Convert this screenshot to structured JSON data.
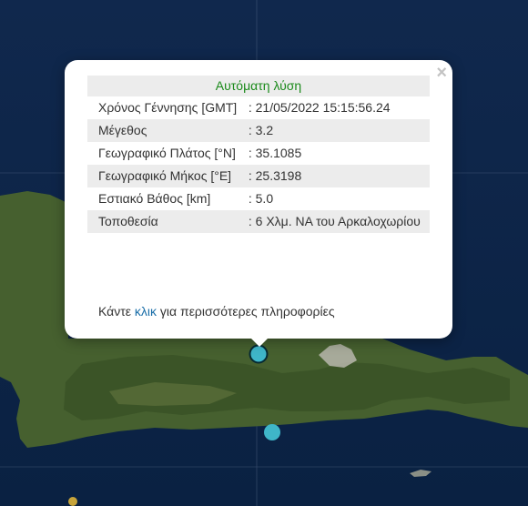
{
  "popup": {
    "title": "Αυτόματη λύση",
    "rows": [
      {
        "label": "Χρόνος Γέννησης [GMT]",
        "value": ": 21/05/2022 15:15:56.24"
      },
      {
        "label": "Μέγεθος",
        "value": ": 3.2"
      },
      {
        "label": "Γεωγραφικό Πλάτος [°N]",
        "value": ": 35.1085"
      },
      {
        "label": "Γεωγραφικό Μήκος [°E]",
        "value": ": 25.3198"
      },
      {
        "label": "Εστιακό Βάθος [km]",
        "value": ": 5.0"
      },
      {
        "label": "Τοποθεσία",
        "value": ": 6 Χλμ. ΝΑ του Αρκαλοχωρίου"
      }
    ],
    "more_prefix": "Κάντε ",
    "more_link": "κλικ",
    "more_suffix": " για περισσότερες πληροφορίες",
    "close_label": "×"
  },
  "map": {
    "colors": {
      "sea": "#0c2447",
      "land": "#3f5a2c",
      "marker": "#3fb6c9",
      "marker_small": "#c7a43a"
    },
    "markers": [
      {
        "name": "selected-earthquake-marker",
        "selected": true
      },
      {
        "name": "earthquake-marker",
        "selected": false
      },
      {
        "name": "earthquake-marker-small",
        "selected": false
      }
    ]
  }
}
